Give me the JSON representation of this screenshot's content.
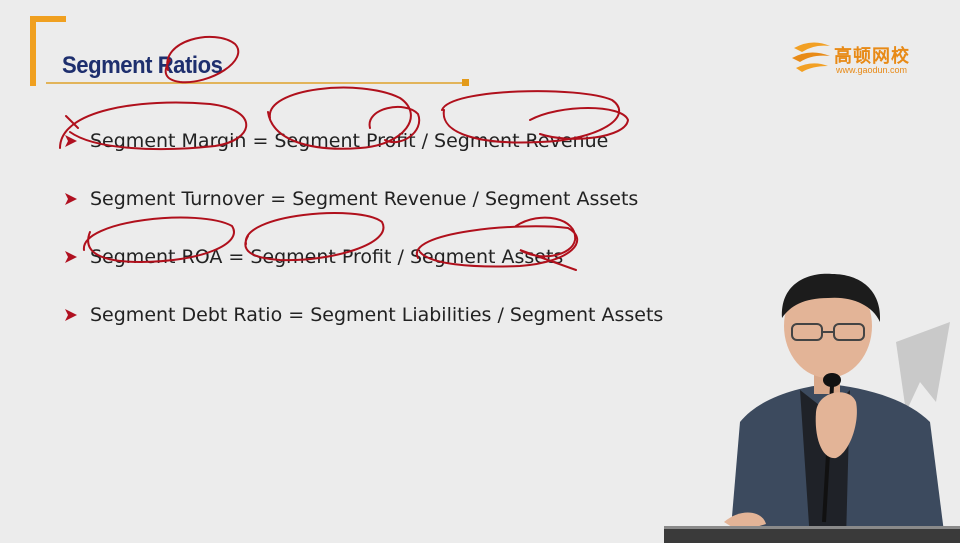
{
  "slide": {
    "title": "Segment Ratios",
    "logo": {
      "chinese_name": "高顿网校",
      "url": "www.gaodun.com"
    },
    "bullets": [
      {
        "text": "Segment Margin = Segment Profit / Segment Revenue"
      },
      {
        "text": "Segment Turnover = Segment Revenue / Segment Assets"
      },
      {
        "text": "Segment ROA = Segment Profit / Segment Assets"
      },
      {
        "text": "Segment Debt Ratio = Segment Liabilities / Segment Assets"
      }
    ]
  },
  "colors": {
    "background": "#ececec",
    "title": "#1e2f6e",
    "accent_orange": "#f0a020",
    "bullet_arrow": "#b01020",
    "annotation_ink": "#b0101c",
    "body_text": "#222222"
  },
  "icons": [
    "bullet-arrow-icon",
    "gaodun-logo-icon"
  ]
}
